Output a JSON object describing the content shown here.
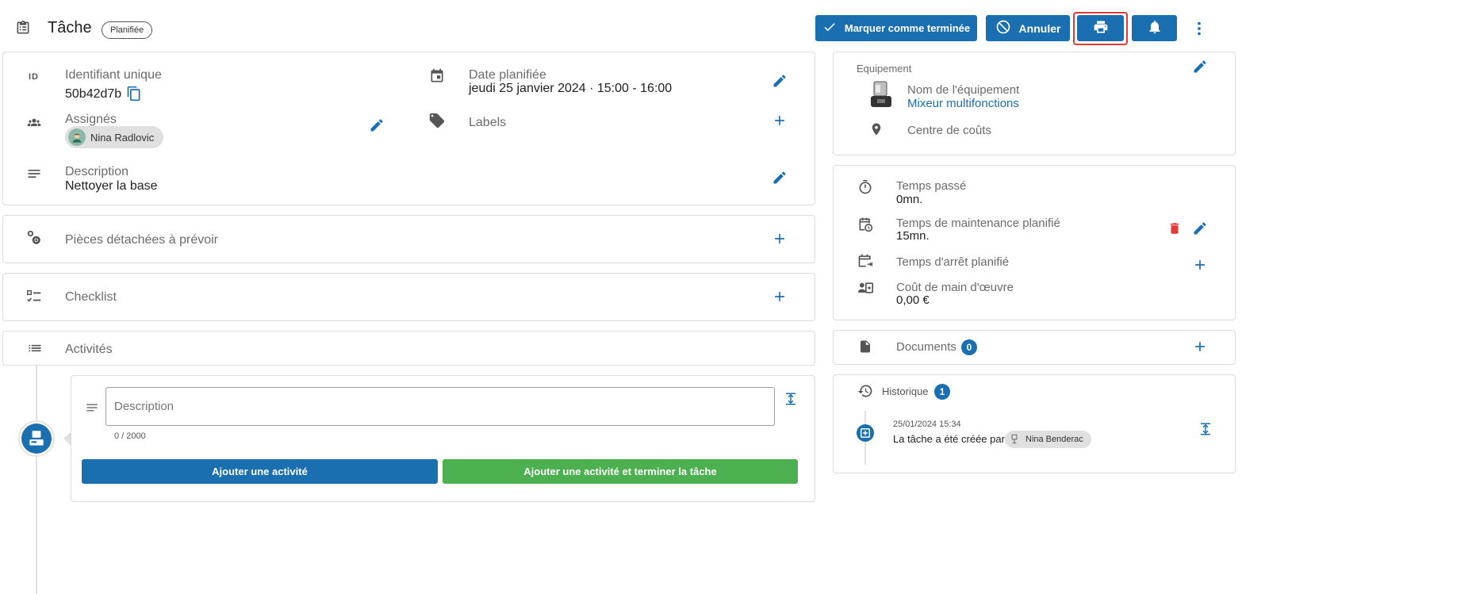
{
  "header": {
    "title": "Tâche",
    "status": "Planifiée",
    "mark_done_label": "Marquer comme terminée",
    "cancel_label": "Annuler"
  },
  "info": {
    "id_label": "Identifiant unique",
    "id_value": "50b42d7b",
    "date_label": "Date planifiée",
    "date_value": "jeudi 25 janvier 2024 · 15:00 - 16:00",
    "assignees_label": "Assignés",
    "assignee_name": "Nina Radlovic",
    "labels_label": "Labels",
    "description_label": "Description",
    "description_value": "Nettoyer la base"
  },
  "sections": {
    "parts_label": "Pièces détachées à prévoir",
    "checklist_label": "Checklist",
    "activities_label": "Activités"
  },
  "activity_form": {
    "description_placeholder": "Description",
    "char_count": "0 / 2000",
    "add_label": "Ajouter une activité",
    "add_finish_label": "Ajouter une activité et terminer la tâche"
  },
  "equipment": {
    "section_label": "Equipement",
    "name_label": "Nom de l'équipement",
    "name_value": "Mixeur multifonctions",
    "cost_center_label": "Centre de coûts"
  },
  "times": {
    "spent_label": "Temps passé",
    "spent_value": "0mn.",
    "planned_label": "Temps de maintenance planifié",
    "planned_value": "15mn.",
    "downtime_label": "Temps d'arrêt planifié",
    "labor_label": "Coût de main d'œuvre",
    "labor_value": "0,00 €"
  },
  "documents": {
    "label": "Documents",
    "count": "0"
  },
  "history": {
    "label": "Historique",
    "count": "1",
    "entry_time": "25/01/2024 15:34",
    "entry_text": "La tâche a été créée par",
    "entry_user": "Nina Benderac"
  },
  "colors": {
    "primary": "#1a6fb0",
    "success": "#4caf50",
    "danger": "#e53935",
    "highlight": "#e53935"
  }
}
